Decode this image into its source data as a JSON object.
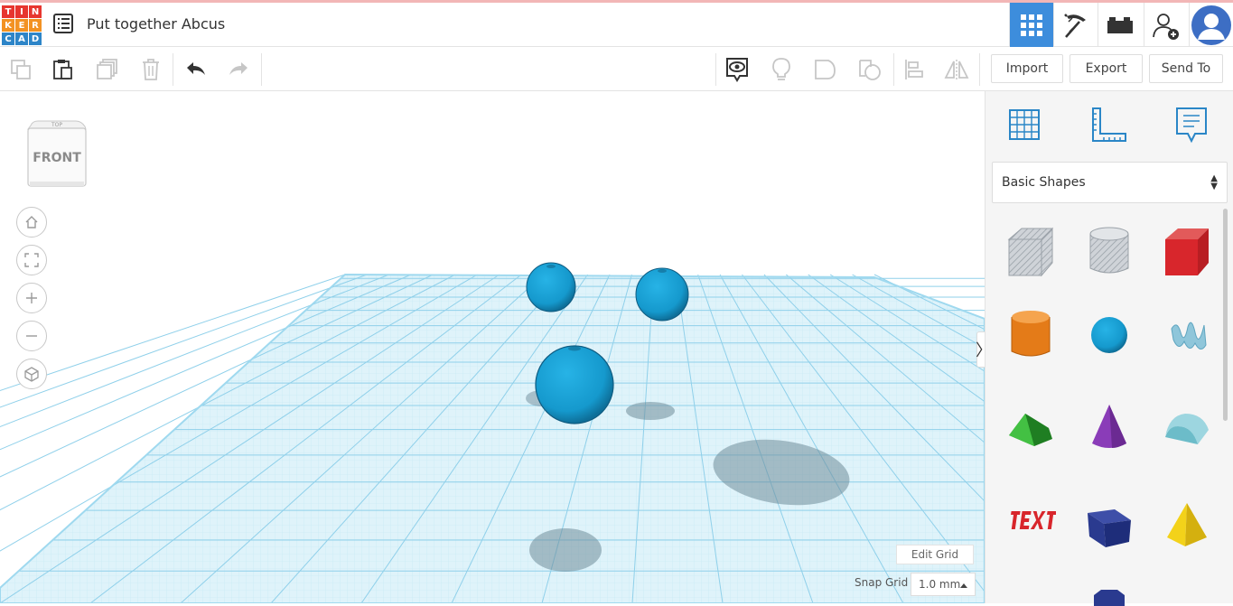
{
  "header": {
    "logo_letters": [
      "T",
      "I",
      "N",
      "K",
      "E",
      "R",
      "C",
      "A",
      "D"
    ],
    "logo_colors": [
      "#e7362f",
      "#e7362f",
      "#e7362f",
      "#f39223",
      "#f39223",
      "#f39223",
      "#2d85c8",
      "#2d85c8",
      "#2d85c8"
    ],
    "title": "Put together Abcus"
  },
  "toolbar": {
    "import_label": "Import",
    "export_label": "Export",
    "send_to_label": "Send To"
  },
  "viewport": {
    "view_cube_label": "FRONT",
    "view_cube_top_label": "TOP",
    "edit_grid_label": "Edit Grid",
    "snap_grid_label": "Snap Grid",
    "snap_grid_value": "1.0 mm"
  },
  "panel": {
    "shape_category": "Basic Shapes",
    "collapse_glyph": "〉"
  },
  "colors": {
    "accent": "#3d8ddc",
    "sphere": "#1aa1d8",
    "grid": "#9fd9ef"
  }
}
